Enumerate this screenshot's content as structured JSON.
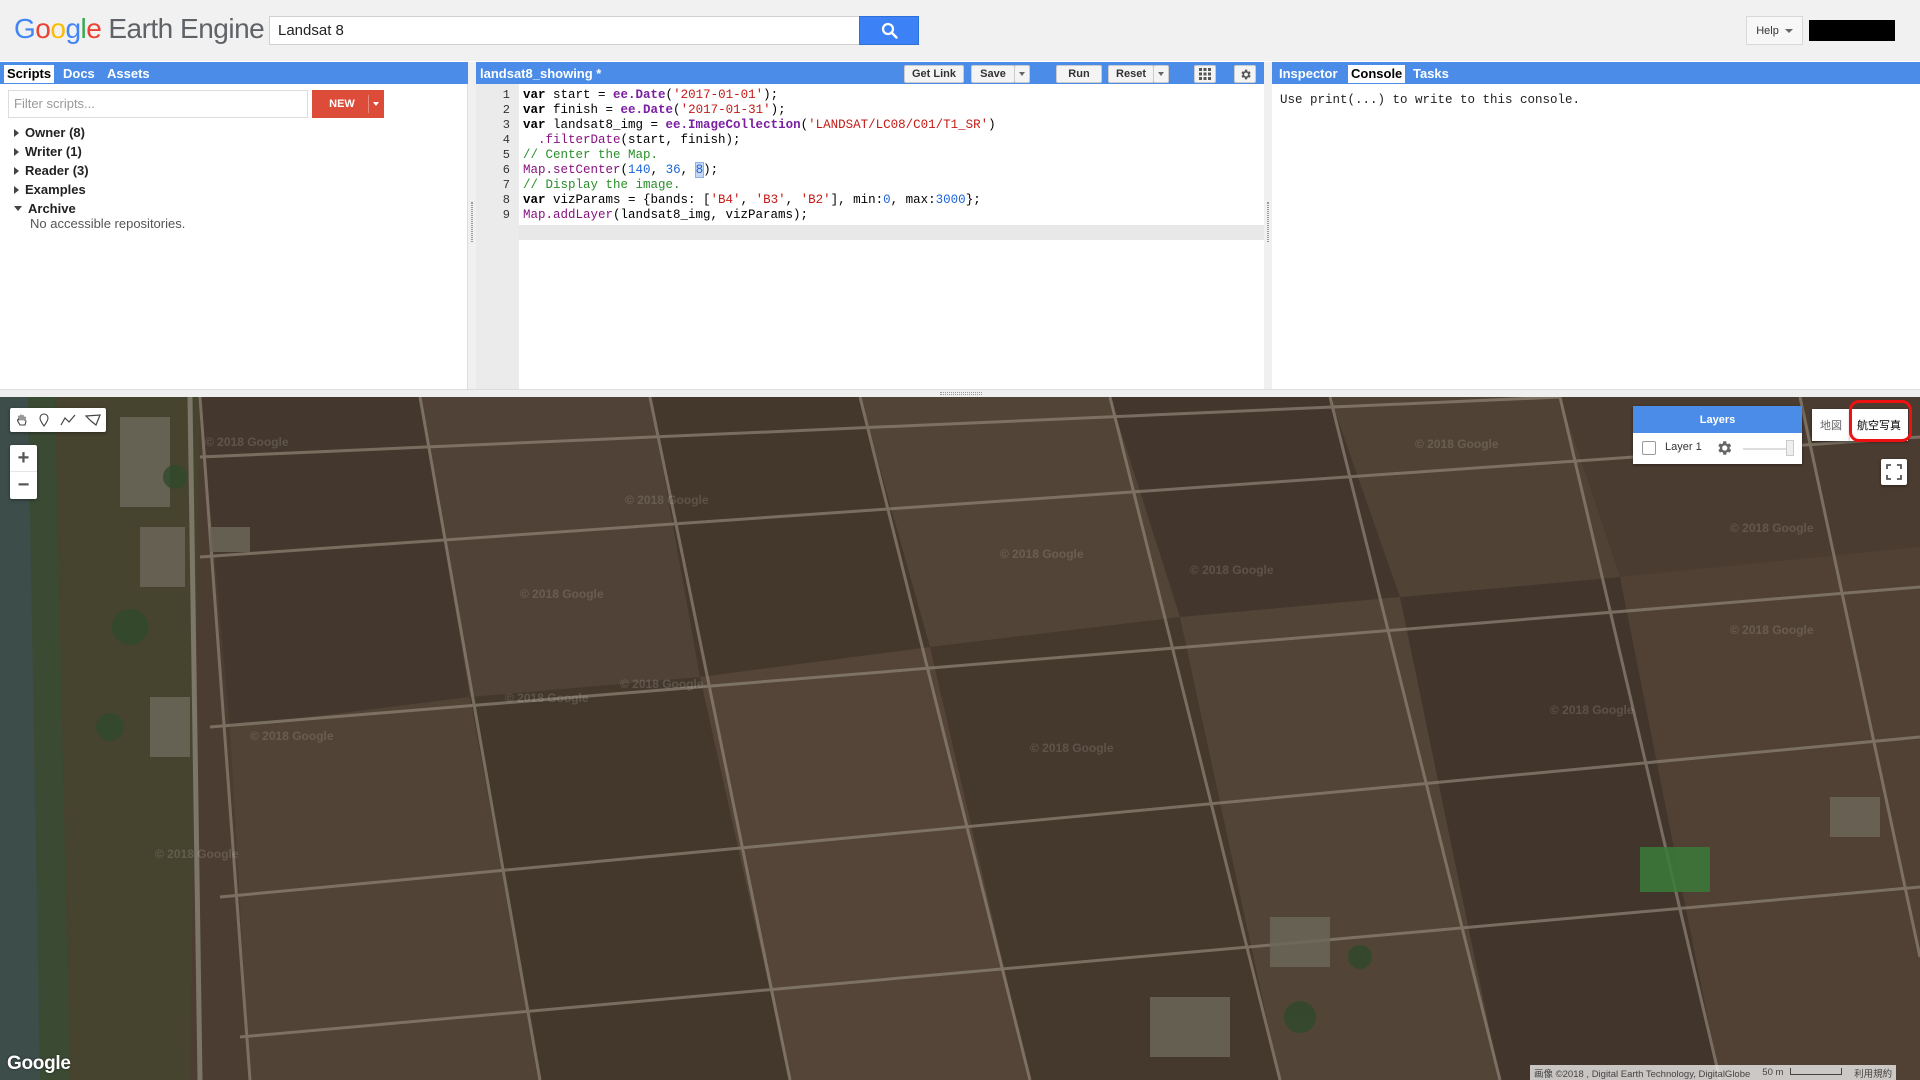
{
  "header": {
    "logo_google": [
      "G",
      "o",
      "o",
      "g",
      "l",
      "e"
    ],
    "logo_product": "Earth Engine",
    "search_value": "Landsat 8",
    "help_label": "Help"
  },
  "left_panel": {
    "tabs": [
      "Scripts",
      "Docs",
      "Assets"
    ],
    "filter_placeholder": "Filter scripts...",
    "new_label": "NEW",
    "tree": [
      {
        "label": "Owner  (8)",
        "expanded": false
      },
      {
        "label": "Writer  (1)",
        "expanded": false
      },
      {
        "label": "Reader  (3)",
        "expanded": false
      },
      {
        "label": "Examples",
        "expanded": false
      },
      {
        "label": "Archive",
        "expanded": true
      }
    ],
    "archive_empty": "No accessible repositories."
  },
  "editor": {
    "title": "landsat8_showing *",
    "buttons": {
      "get_link": "Get Link",
      "save": "Save",
      "run": "Run",
      "reset": "Reset"
    },
    "line_numbers": [
      "1",
      "2",
      "3",
      "4",
      "5",
      "6",
      "7",
      "8",
      "9"
    ],
    "code": [
      "var start = ee.Date('2017-01-01');",
      "var finish = ee.Date('2017-01-31');",
      "var landsat8_img = ee.ImageCollection('LANDSAT/LC08/C01/T1_SR')",
      "  .filterDate(start, finish);",
      "// Center the Map.",
      "Map.setCenter(140, 36, 8);",
      "// Display the image.",
      "var vizParams = {bands: ['B4', 'B3', 'B2'], min:0, max:3000};",
      "Map.addLayer(landsat8_img, vizParams);"
    ]
  },
  "right_panel": {
    "tabs": [
      "Inspector",
      "Console",
      "Tasks"
    ],
    "active_tab": "Console",
    "console_text": "Use print(...) to write to this console."
  },
  "map": {
    "layers_title": "Layers",
    "layer_name": "Layer 1",
    "map_type_map": "地図",
    "map_type_satellite": "航空写真",
    "google_watermark": "Google",
    "watermark_text": "© 2018 Google",
    "attribution": "画像 ©2018 , Digital Earth Technology, DigitalGlobe",
    "scale_label": "50 m",
    "terms": "利用規約"
  },
  "colors": {
    "accent_blue": "#4a8ce8",
    "new_button_red": "#dd4b39",
    "highlight_red": "#ee1111"
  }
}
